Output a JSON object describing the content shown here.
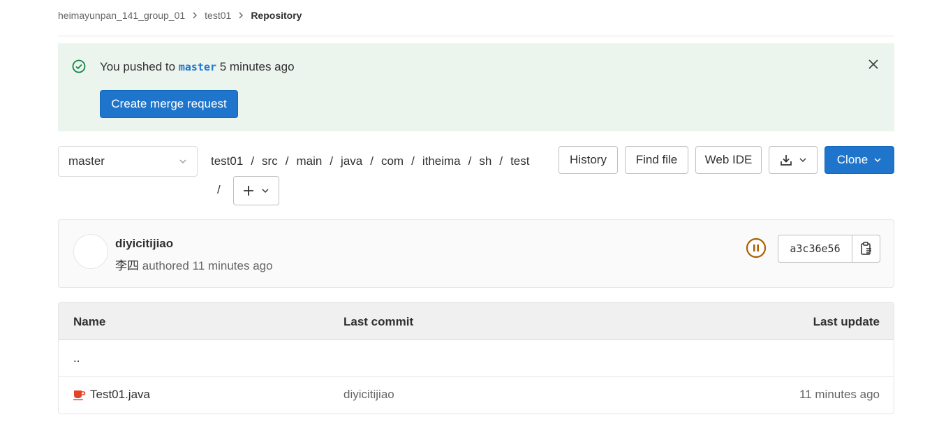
{
  "breadcrumb": {
    "group": "heimayunpan_141_group_01",
    "project": "test01",
    "current": "Repository"
  },
  "alert": {
    "prefix": "You pushed to",
    "branch": "master",
    "suffix": "5 minutes ago",
    "button": "Create merge request"
  },
  "branch_selector": {
    "value": "master"
  },
  "path": [
    "test01",
    "src",
    "main",
    "java",
    "com",
    "itheima",
    "sh",
    "test"
  ],
  "path_separator": "/",
  "toolbar": {
    "history": "History",
    "find_file": "Find file",
    "web_ide": "Web IDE",
    "clone": "Clone"
  },
  "commit": {
    "title": "diyicitijiao",
    "author": "李四",
    "authored": "authored 11 minutes ago",
    "sha": "a3c36e56"
  },
  "table": {
    "headers": {
      "name": "Name",
      "last_commit": "Last commit",
      "last_update": "Last update"
    },
    "parent": "..",
    "rows": [
      {
        "name": "Test01.java",
        "last_commit": "diyicitijiao",
        "last_update": "11 minutes ago"
      }
    ]
  },
  "colors": {
    "primary": "#1f75cb",
    "alert_bg": "#ecf4ee",
    "success": "#108548",
    "pipeline_paused": "#ab6100",
    "java_icon": "#e24329"
  }
}
